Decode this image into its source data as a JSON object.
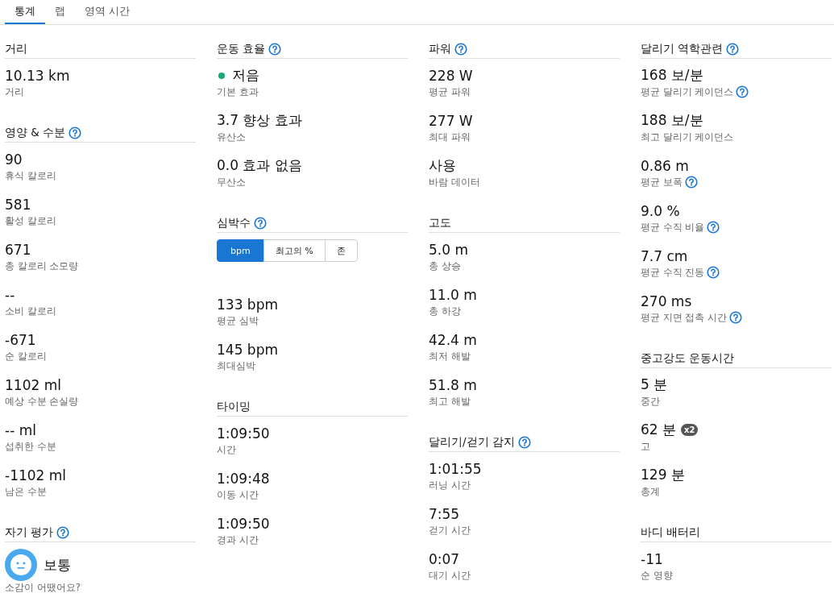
{
  "tabs": [
    {
      "label": "통계",
      "selected": true
    },
    {
      "label": "랩",
      "selected": false
    },
    {
      "label": "영역 시간",
      "selected": false
    }
  ],
  "columns": [
    {
      "sections": [
        {
          "title": "거리",
          "help": false,
          "stats": [
            {
              "kind": "plain",
              "value": "10.13 km",
              "label": "거리",
              "help": false
            }
          ]
        },
        {
          "title": "영양 & 수분",
          "help": true,
          "stats": [
            {
              "kind": "plain",
              "value": "90",
              "label": "휴식 칼로리",
              "help": false
            },
            {
              "kind": "plain",
              "value": "581",
              "label": "활성 칼로리",
              "help": false
            },
            {
              "kind": "plain",
              "value": "671",
              "label": "총 칼로리 소모량",
              "help": false
            },
            {
              "kind": "plain",
              "value": "--",
              "label": "소비 칼로리",
              "help": false
            },
            {
              "kind": "plain",
              "value": "-671",
              "label": "순 칼로리",
              "help": false
            },
            {
              "kind": "plain",
              "value": "1102 ml",
              "label": "예상 수분 손실량",
              "help": false
            },
            {
              "kind": "plain",
              "value": "-- ml",
              "label": "섭취한 수분",
              "help": false
            },
            {
              "kind": "plain",
              "value": "-1102 ml",
              "label": "남은 수분",
              "help": false
            }
          ]
        },
        {
          "title": "자기 평가",
          "help": true,
          "stats": [
            {
              "kind": "mood",
              "value": "보통",
              "label": "소감이 어땠어요?",
              "help": false
            }
          ]
        }
      ]
    },
    {
      "sections": [
        {
          "title": "운동 효율",
          "help": true,
          "stats": [
            {
              "kind": "status",
              "color": "#19a974",
              "value": "저음",
              "label": "기본 효과",
              "help": false
            },
            {
              "kind": "plain",
              "value": "3.7 향상 효과",
              "label": "유산소",
              "help": false
            },
            {
              "kind": "plain",
              "value": "0.0 효과 없음",
              "label": "무산소",
              "help": false
            }
          ]
        },
        {
          "title": "심박수",
          "help": true,
          "segments": [
            {
              "label": "bpm",
              "selected": true
            },
            {
              "label": "최고의 %",
              "selected": false
            },
            {
              "label": "존",
              "selected": false
            }
          ],
          "stats": [
            {
              "kind": "plain",
              "value": "133 bpm",
              "label": "평균 심박",
              "help": false
            },
            {
              "kind": "plain",
              "value": "145 bpm",
              "label": "최대심박",
              "help": false
            }
          ]
        },
        {
          "title": "타이밍",
          "help": false,
          "stats": [
            {
              "kind": "plain",
              "value": "1:09:50",
              "label": "시간",
              "help": false
            },
            {
              "kind": "plain",
              "value": "1:09:48",
              "label": "이동 시간",
              "help": false
            },
            {
              "kind": "plain",
              "value": "1:09:50",
              "label": "경과 시간",
              "help": false
            }
          ]
        }
      ]
    },
    {
      "sections": [
        {
          "title": "파워",
          "help": true,
          "stats": [
            {
              "kind": "plain",
              "value": "228 W",
              "label": "평균 파워",
              "help": false
            },
            {
              "kind": "plain",
              "value": "277 W",
              "label": "최대 파워",
              "help": false
            },
            {
              "kind": "plain",
              "value": "사용",
              "label": "바람 데이터",
              "help": false
            }
          ]
        },
        {
          "title": "고도",
          "help": false,
          "stats": [
            {
              "kind": "plain",
              "value": "5.0 m",
              "label": "총 상승",
              "help": false
            },
            {
              "kind": "plain",
              "value": "11.0 m",
              "label": "총 하강",
              "help": false
            },
            {
              "kind": "plain",
              "value": "42.4 m",
              "label": "최저 해발",
              "help": false
            },
            {
              "kind": "plain",
              "value": "51.8 m",
              "label": "최고 해발",
              "help": false
            }
          ]
        },
        {
          "title": "달리기/걷기 감지",
          "help": true,
          "stats": [
            {
              "kind": "plain",
              "value": "1:01:55",
              "label": "러닝 시간",
              "help": false
            },
            {
              "kind": "plain",
              "value": "7:55",
              "label": "걷기 시간",
              "help": false
            },
            {
              "kind": "plain",
              "value": "0:07",
              "label": "대기 시간",
              "help": false
            }
          ]
        }
      ]
    },
    {
      "sections": [
        {
          "title": "달리기 역학관련",
          "help": true,
          "stats": [
            {
              "kind": "plain",
              "value": "168 보/분",
              "label": "평균 달리기 케이던스",
              "help": true
            },
            {
              "kind": "plain",
              "value": "188 보/분",
              "label": "최고 달리기 케이던스",
              "help": false
            },
            {
              "kind": "plain",
              "value": "0.86 m",
              "label": "평균 보폭",
              "help": true
            },
            {
              "kind": "plain",
              "value": "9.0 %",
              "label": "평균 수직 비율",
              "help": true
            },
            {
              "kind": "plain",
              "value": "7.7 cm",
              "label": "평균 수직 진동",
              "help": true
            },
            {
              "kind": "plain",
              "value": "270 ms",
              "label": "평균 지면 접촉 시간",
              "help": true
            }
          ]
        },
        {
          "title": "중고강도 운동시간",
          "help": false,
          "stats": [
            {
              "kind": "plain",
              "value": "5 분",
              "label": "중간",
              "help": false
            },
            {
              "kind": "plain",
              "value": "62 분",
              "badge": "x2",
              "label": "고",
              "help": false
            },
            {
              "kind": "plain",
              "value": "129 분",
              "label": "총계",
              "help": false
            }
          ]
        },
        {
          "title": "바디 배터리",
          "help": false,
          "stats": [
            {
              "kind": "plain",
              "value": "-11",
              "label": "순 영향",
              "help": false
            }
          ]
        }
      ]
    }
  ]
}
